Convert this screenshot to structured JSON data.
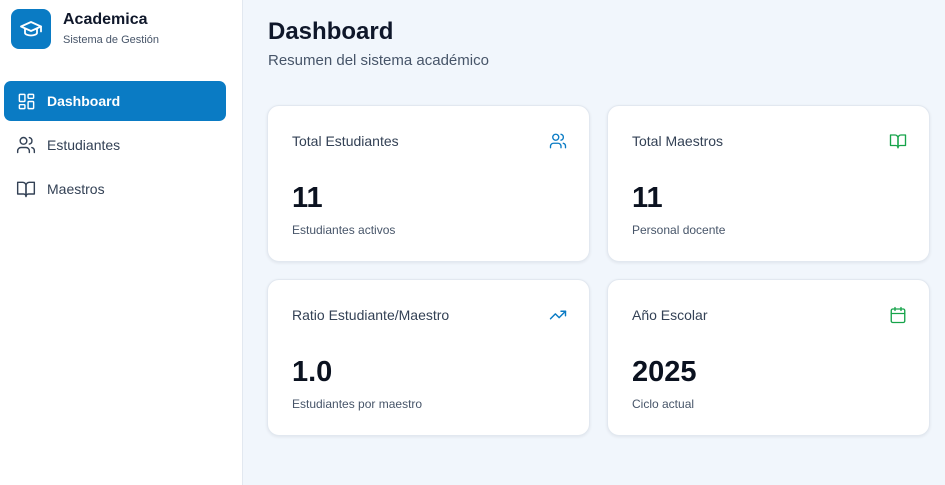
{
  "brand": {
    "name": "Academica",
    "subtitle": "Sistema de Gestión",
    "icon": "graduation-cap-icon",
    "color": "#0a7bc4"
  },
  "sidebar": {
    "items": [
      {
        "label": "Dashboard",
        "icon": "dashboard-grid-icon",
        "active": true
      },
      {
        "label": "Estudiantes",
        "icon": "users-icon",
        "active": false
      },
      {
        "label": "Maestros",
        "icon": "book-open-icon",
        "active": false
      }
    ]
  },
  "header": {
    "title": "Dashboard",
    "subtitle": "Resumen del sistema académico"
  },
  "cards": [
    {
      "title": "Total Estudiantes",
      "value": "11",
      "description": "Estudiantes activos",
      "icon": "users-icon",
      "icon_color": "#0a7bc4"
    },
    {
      "title": "Total Maestros",
      "value": "11",
      "description": "Personal docente",
      "icon": "book-open-icon",
      "icon_color": "#16a34a"
    },
    {
      "title": "Ratio Estudiante/Maestro",
      "value": "1.0",
      "description": "Estudiantes por maestro",
      "icon": "trending-up-icon",
      "icon_color": "#0a7bc4"
    },
    {
      "title": "Año Escolar",
      "value": "2025",
      "description": "Ciclo actual",
      "icon": "calendar-icon",
      "icon_color": "#16a34a"
    }
  ]
}
